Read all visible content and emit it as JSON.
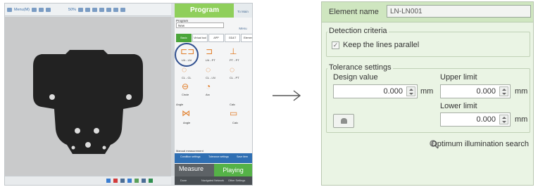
{
  "left_screenshot": {
    "toolbar": {
      "menu_label": "Menu(M)",
      "zoom_label": "50%"
    },
    "panel": {
      "header_title": "Program",
      "header_menu_label": "To Main Menu",
      "program_label": "Program",
      "program_value": "New",
      "tabs": [
        "Basic",
        "Virtual tool",
        "APP",
        "GD&T",
        "Element"
      ],
      "tool_labels": [
        "LN - LN",
        "LN - PT",
        "PT - PT",
        "CL - CL",
        "CL - LN",
        "CL - PT",
        "Circle",
        "Arc"
      ],
      "section_angle": "Angle",
      "section_calc": "Calc",
      "angle_item": "Angle",
      "calc_item": "Calc",
      "manual_measurement": "Manual measurement",
      "footer_items": [
        "Condition settings",
        "Tolerance settings",
        "Save item"
      ],
      "measure_label": "Measure",
      "playing_label": "Playing",
      "sub_items": [
        "Done",
        "Navigated Network",
        "Other Settings"
      ]
    }
  },
  "right_screenshot": {
    "element_name_label": "Element name",
    "element_name_value": "LN-LN001",
    "detection_title": "Detection criteria",
    "keep_parallel_label": "Keep the lines parallel",
    "keep_parallel_checked": true,
    "tolerance_title": "Tolerance settings",
    "design_value_label": "Design value",
    "design_value": "0.000",
    "upper_limit_label": "Upper limit",
    "upper_limit": "0.000",
    "lower_limit_label": "Lower limit",
    "lower_limit": "0.000",
    "unit": "mm",
    "optimum_label": "Optimum illumination search"
  },
  "colors": {
    "accent_green": "#8fcf5b",
    "panel_bg": "#eaf4e4",
    "part_black": "#222222",
    "highlight_circle": "#2f4f8f"
  }
}
